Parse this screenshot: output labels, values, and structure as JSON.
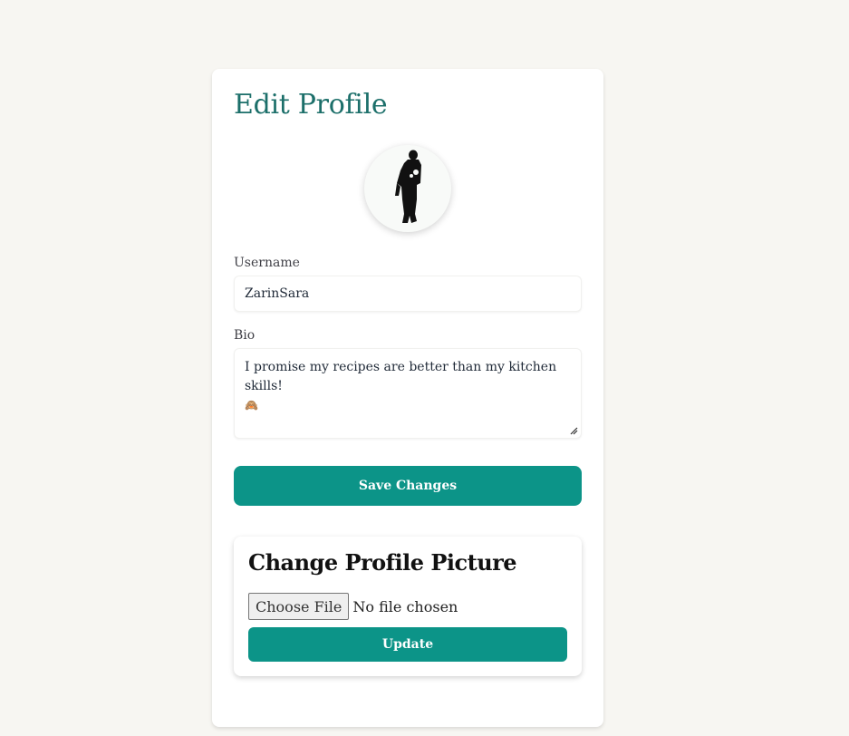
{
  "page": {
    "title": "Edit Profile"
  },
  "avatar": {
    "alt": "profile photo"
  },
  "form": {
    "username_label": "Username",
    "username_value": "ZarinSara",
    "bio_label": "Bio",
    "bio_value": "I promise my recipes are better than my kitchen skills!",
    "bio_emoji": "🙈",
    "save_label": "Save Changes"
  },
  "picture_section": {
    "title": "Change Profile Picture",
    "choose_file_label": "Choose File",
    "no_file_text": "No file chosen",
    "update_label": "Update"
  },
  "colors": {
    "accent": "#0c9488",
    "title": "#1c6f6a",
    "background": "#f7f6f2"
  }
}
